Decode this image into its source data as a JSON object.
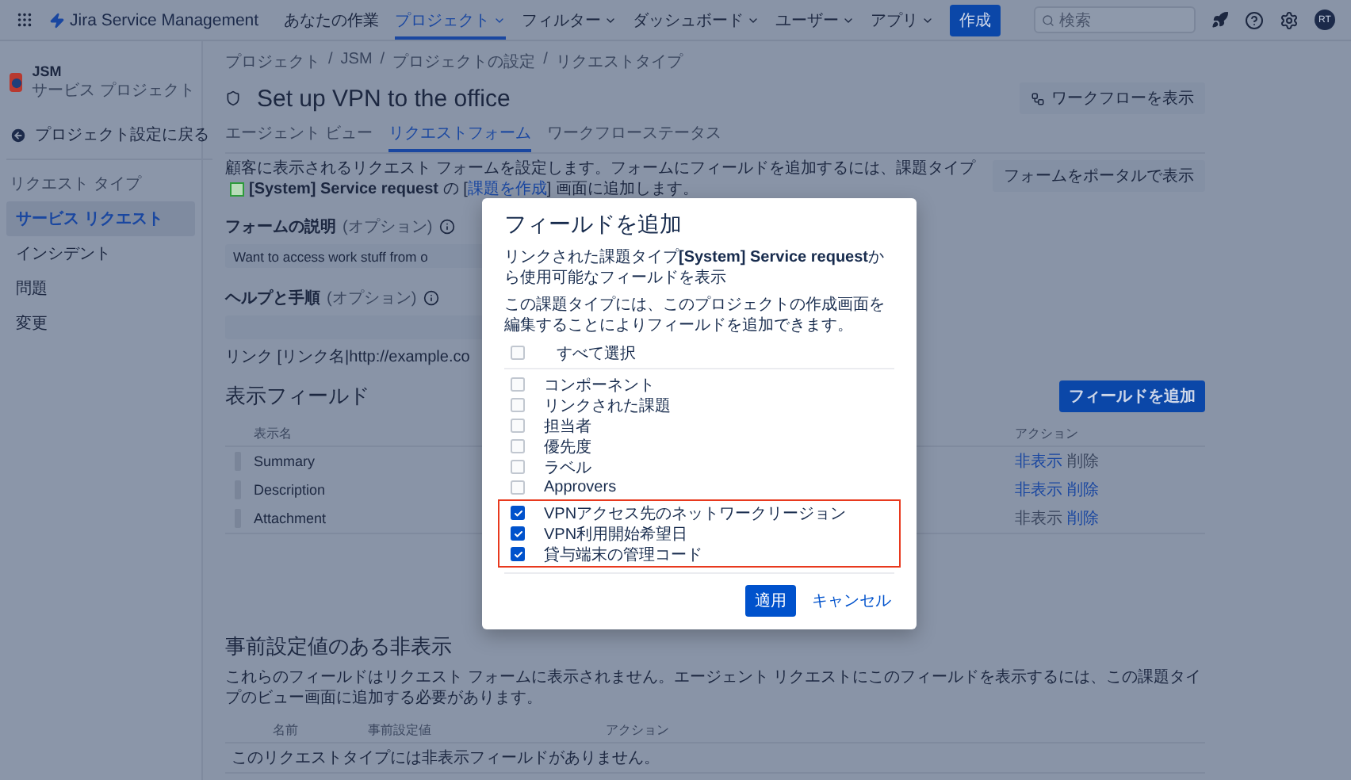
{
  "top_nav": {
    "product": "Jira Service Management",
    "items": [
      {
        "label": "あなたの作業",
        "selected": false,
        "dropdown": false
      },
      {
        "label": "プロジェクト",
        "selected": true,
        "dropdown": true
      },
      {
        "label": "フィルター",
        "selected": false,
        "dropdown": true
      },
      {
        "label": "ダッシュボード",
        "selected": false,
        "dropdown": true
      },
      {
        "label": "ユーザー",
        "selected": false,
        "dropdown": true
      },
      {
        "label": "アプリ",
        "selected": false,
        "dropdown": true
      }
    ],
    "create_button": "作成",
    "search": {
      "placeholder": "検索"
    },
    "avatar": "RT"
  },
  "sidebar": {
    "project": {
      "name": "JSM",
      "type": "サービス プロジェクト"
    },
    "back_link": "プロジェクト設定に戻る",
    "section_title": "リクエスト タイプ",
    "items": [
      {
        "label": "サービス リクエスト",
        "selected": true
      },
      {
        "label": "インシデント",
        "selected": false
      },
      {
        "label": "問題",
        "selected": false
      },
      {
        "label": "変更",
        "selected": false
      }
    ]
  },
  "breadcrumbs": [
    "プロジェクト",
    "JSM",
    "プロジェクトの設定",
    "リクエストタイプ"
  ],
  "breadcrumb_separator": "/",
  "page_title": "Set up VPN to the office",
  "workflow_button": "ワークフローを表示",
  "tabs": [
    {
      "label": "エージェント ビュー",
      "selected": false
    },
    {
      "label": "リクエストフォーム",
      "selected": true
    },
    {
      "label": "ワークフローステータス",
      "selected": false
    }
  ],
  "intro": {
    "before": "顧客に表示されるリクエスト フォームを設定します。フォームにフィールドを追加するには、課題タイプ",
    "issue_type": "[System] Service request",
    "middle": "の [",
    "link": "課題を作成",
    "after": "] 画面に追加します。"
  },
  "portal_button": "フォームをポータルで表示",
  "form_description": {
    "label": "フォームの説明",
    "optional": "(オプション)",
    "value": "Want to access work stuff from o"
  },
  "help": {
    "label": "ヘルプと手順",
    "optional": "(オプション)",
    "hint": "リンク [リンク名|http://example.co"
  },
  "visible_fields": {
    "title": "表示フィールド",
    "add_button": "フィールドを追加",
    "columns": [
      "表示名",
      "アクション"
    ],
    "rows": [
      {
        "name": "Summary",
        "actions": [
          {
            "label": "非表示",
            "disabled": false
          },
          {
            "label": "削除",
            "disabled": true
          }
        ]
      },
      {
        "name": "Description",
        "actions": [
          {
            "label": "非表示",
            "disabled": false
          },
          {
            "label": "削除",
            "disabled": false
          }
        ]
      },
      {
        "name": "Attachment",
        "actions": [
          {
            "label": "非表示",
            "disabled": true
          },
          {
            "label": "削除",
            "disabled": false
          }
        ]
      }
    ]
  },
  "hidden_fields": {
    "title": "事前設定値のある非表示",
    "description": "これらのフィールドはリクエスト フォームに表示されません。エージェント リクエストにこのフィールドを表示するには、この課題タイプのビュー画面に追加する必要があります。",
    "columns": [
      "名前",
      "事前設定値",
      "アクション"
    ],
    "empty_message": "このリクエストタイプには非表示フィールドがありません。"
  },
  "modal": {
    "title": "フィールドを追加",
    "description": "リンクされた課題タイプ**[System] Service request**から使用可能なフィールドを表示",
    "note": "この課題タイプには、このプロジェクトの作成画面を編集することによりフィールドを追加できます。",
    "select_all": {
      "label": "すべて選択",
      "checked": false
    },
    "fields": [
      {
        "label": "コンポーネント",
        "checked": false,
        "highlighted": false
      },
      {
        "label": "リンクされた課題",
        "checked": false,
        "highlighted": false
      },
      {
        "label": "担当者",
        "checked": false,
        "highlighted": false
      },
      {
        "label": "優先度",
        "checked": false,
        "highlighted": false
      },
      {
        "label": "ラベル",
        "checked": false,
        "highlighted": false
      },
      {
        "label": "Approvers",
        "checked": false,
        "highlighted": false
      },
      {
        "label": "VPNアクセス先のネットワークリージョン",
        "checked": true,
        "highlighted": true
      },
      {
        "label": "VPN利用開始希望日",
        "checked": true,
        "highlighted": true
      },
      {
        "label": "貸与端末の管理コード",
        "checked": true,
        "highlighted": true
      }
    ],
    "apply": "適用",
    "cancel": "キャンセル"
  }
}
